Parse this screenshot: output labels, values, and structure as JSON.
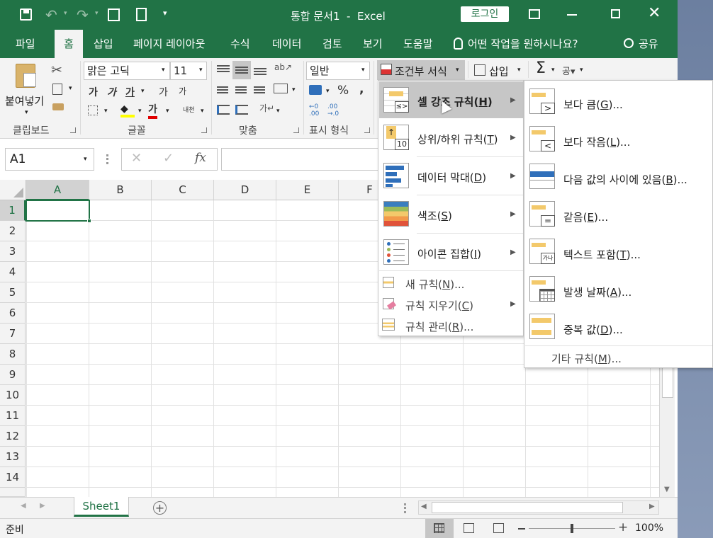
{
  "titlebar": {
    "title": "통합 문서1  -  Excel",
    "login": "로그인"
  },
  "tabs": [
    "파일",
    "홈",
    "삽입",
    "페이지 레이아웃",
    "수식",
    "데이터",
    "검토",
    "보기",
    "도움말"
  ],
  "tellme": "어떤 작업을 원하시나요?",
  "share": "공유",
  "ribbon": {
    "paste": "붙여넣기",
    "clipboard": "클립보드",
    "font_name": "맑은 고딕",
    "font_size": "11",
    "font_group": "글꼴",
    "align_group": "맞춤",
    "number_format": "일반",
    "number_group": "표시 형식",
    "cond_format": "조건부 서식",
    "insert": "삽입",
    "bold": "가",
    "italic": "가",
    "underline": "가",
    "grow": "가",
    "shrink": "가",
    "phonetic": "내천",
    "font_color": "가",
    "percent": "%",
    "comma": ",",
    "sigma": "Σ",
    "sort": "공▾"
  },
  "namebox": "A1",
  "fx": "fx",
  "columns": [
    "A",
    "B",
    "C",
    "D",
    "E",
    "F"
  ],
  "rows": [
    "1",
    "2",
    "3",
    "4",
    "5",
    "6",
    "7",
    "8",
    "9",
    "10",
    "11",
    "12",
    "13",
    "14"
  ],
  "sheet_tab": "Sheet1",
  "status": {
    "ready": "준비",
    "zoom": "100%"
  },
  "menu1": {
    "items": [
      {
        "pre": "셀 강조 규칙(",
        "key": "H",
        "post": ")"
      },
      {
        "pre": "상위/하위 규칙(",
        "key": "T",
        "post": ")"
      },
      {
        "pre": "데이터 막대(",
        "key": "D",
        "post": ")"
      },
      {
        "pre": "색조(",
        "key": "S",
        "post": ")"
      },
      {
        "pre": "아이콘 집합(",
        "key": "I",
        "post": ")"
      }
    ],
    "small": [
      {
        "pre": "새 규칙(",
        "key": "N",
        "post": ")..."
      },
      {
        "pre": "규칙 지우기(",
        "key": "C",
        "post": ")"
      },
      {
        "pre": "규칙 관리(",
        "key": "R",
        "post": ")..."
      }
    ],
    "topbottom_num": "10"
  },
  "menu2": {
    "items": [
      {
        "pre": "보다 큼(",
        "key": "G",
        "post": ")..."
      },
      {
        "pre": "보다 작음(",
        "key": "L",
        "post": ")..."
      },
      {
        "pre": "다음 값의 사이에 있음(",
        "key": "B",
        "post": ")..."
      },
      {
        "pre": "같음(",
        "key": "E",
        "post": ")..."
      },
      {
        "pre": "텍스트 포함(",
        "key": "T",
        "post": ")..."
      },
      {
        "pre": "발생 날짜(",
        "key": "A",
        "post": ")..."
      },
      {
        "pre": "중복 값(",
        "key": "D",
        "post": ")..."
      }
    ],
    "more": {
      "pre": "기타 규칙(",
      "key": "M",
      "post": ")..."
    },
    "text_icon": "가나"
  },
  "colors": {
    "excel_green": "#217346",
    "highlight": "#e6e6e6",
    "bar_blue": "#2f6fba"
  }
}
